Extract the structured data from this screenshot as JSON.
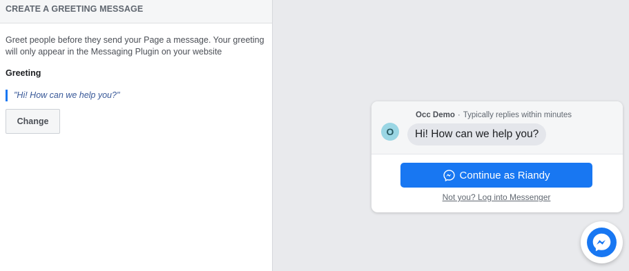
{
  "panel": {
    "header": "CREATE A GREETING MESSAGE",
    "description": "Greet people before they send your Page a message. Your greeting will only appear in the Messaging Plugin on your website",
    "greeting_label": "Greeting",
    "greeting_text": "\"Hi! How can we help you?\"",
    "change_label": "Change"
  },
  "preview": {
    "page_name": "Occ Demo",
    "separator": "·",
    "reply_time": "Typically replies within minutes",
    "avatar_letter": "O",
    "greeting_bubble": "Hi! How can we help you?",
    "continue_label": "Continue as Riandy",
    "login_link": "Not you? Log into Messenger"
  },
  "icons": {
    "continue_icon": "messenger-icon",
    "launcher_icon": "messenger-icon"
  },
  "colors": {
    "accent": "#1877f2",
    "avatar_bg": "#9ad6e4",
    "bubble_bg": "#e4e6eb",
    "page_bg": "#e9eaed"
  }
}
